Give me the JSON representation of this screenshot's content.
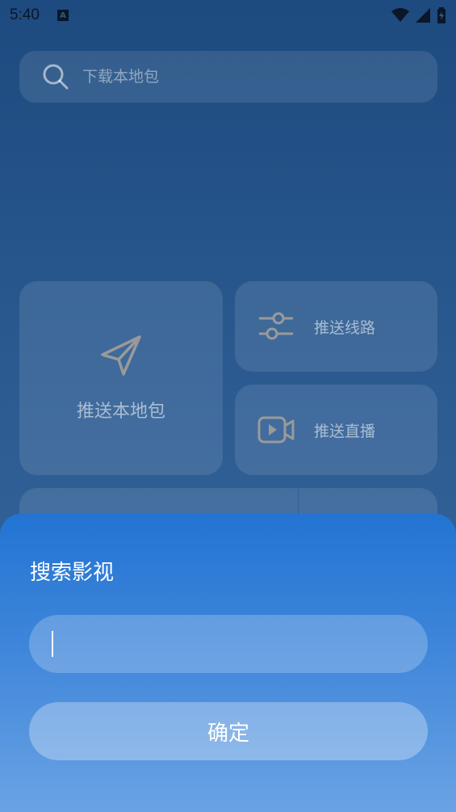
{
  "status_bar": {
    "time": "5:40",
    "notification_letter": "A"
  },
  "search": {
    "placeholder": "下载本地包"
  },
  "tiles": {
    "push_local": {
      "label": "推送本地包"
    },
    "push_route": {
      "label": "推送线路"
    },
    "push_live": {
      "label": "推送直播"
    }
  },
  "dialog": {
    "title": "搜索影视",
    "input_value": "",
    "confirm_label": "确定"
  },
  "colors": {
    "background": "#1d4a7f",
    "sheet_top": "#2274d3",
    "sheet_bottom": "#6aa3e4",
    "icon_gray": "#9a9a9a"
  }
}
